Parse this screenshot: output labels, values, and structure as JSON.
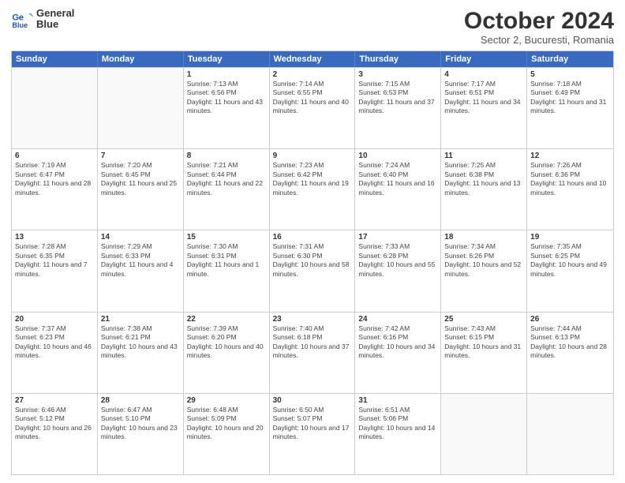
{
  "header": {
    "logo_line1": "General",
    "logo_line2": "Blue",
    "month": "October 2024",
    "location": "Sector 2, Bucuresti, Romania"
  },
  "days_of_week": [
    "Sunday",
    "Monday",
    "Tuesday",
    "Wednesday",
    "Thursday",
    "Friday",
    "Saturday"
  ],
  "weeks": [
    [
      {
        "day": "",
        "text": ""
      },
      {
        "day": "",
        "text": ""
      },
      {
        "day": "1",
        "text": "Sunrise: 7:13 AM\nSunset: 6:56 PM\nDaylight: 11 hours and 43 minutes."
      },
      {
        "day": "2",
        "text": "Sunrise: 7:14 AM\nSunset: 6:55 PM\nDaylight: 11 hours and 40 minutes."
      },
      {
        "day": "3",
        "text": "Sunrise: 7:15 AM\nSunset: 6:53 PM\nDaylight: 11 hours and 37 minutes."
      },
      {
        "day": "4",
        "text": "Sunrise: 7:17 AM\nSunset: 6:51 PM\nDaylight: 11 hours and 34 minutes."
      },
      {
        "day": "5",
        "text": "Sunrise: 7:18 AM\nSunset: 6:49 PM\nDaylight: 11 hours and 31 minutes."
      }
    ],
    [
      {
        "day": "6",
        "text": "Sunrise: 7:19 AM\nSunset: 6:47 PM\nDaylight: 11 hours and 28 minutes."
      },
      {
        "day": "7",
        "text": "Sunrise: 7:20 AM\nSunset: 6:45 PM\nDaylight: 11 hours and 25 minutes."
      },
      {
        "day": "8",
        "text": "Sunrise: 7:21 AM\nSunset: 6:44 PM\nDaylight: 11 hours and 22 minutes."
      },
      {
        "day": "9",
        "text": "Sunrise: 7:23 AM\nSunset: 6:42 PM\nDaylight: 11 hours and 19 minutes."
      },
      {
        "day": "10",
        "text": "Sunrise: 7:24 AM\nSunset: 6:40 PM\nDaylight: 11 hours and 16 minutes."
      },
      {
        "day": "11",
        "text": "Sunrise: 7:25 AM\nSunset: 6:38 PM\nDaylight: 11 hours and 13 minutes."
      },
      {
        "day": "12",
        "text": "Sunrise: 7:26 AM\nSunset: 6:36 PM\nDaylight: 11 hours and 10 minutes."
      }
    ],
    [
      {
        "day": "13",
        "text": "Sunrise: 7:28 AM\nSunset: 6:35 PM\nDaylight: 11 hours and 7 minutes."
      },
      {
        "day": "14",
        "text": "Sunrise: 7:29 AM\nSunset: 6:33 PM\nDaylight: 11 hours and 4 minutes."
      },
      {
        "day": "15",
        "text": "Sunrise: 7:30 AM\nSunset: 6:31 PM\nDaylight: 11 hours and 1 minute."
      },
      {
        "day": "16",
        "text": "Sunrise: 7:31 AM\nSunset: 6:30 PM\nDaylight: 10 hours and 58 minutes."
      },
      {
        "day": "17",
        "text": "Sunrise: 7:33 AM\nSunset: 6:28 PM\nDaylight: 10 hours and 55 minutes."
      },
      {
        "day": "18",
        "text": "Sunrise: 7:34 AM\nSunset: 6:26 PM\nDaylight: 10 hours and 52 minutes."
      },
      {
        "day": "19",
        "text": "Sunrise: 7:35 AM\nSunset: 6:25 PM\nDaylight: 10 hours and 49 minutes."
      }
    ],
    [
      {
        "day": "20",
        "text": "Sunrise: 7:37 AM\nSunset: 6:23 PM\nDaylight: 10 hours and 46 minutes."
      },
      {
        "day": "21",
        "text": "Sunrise: 7:38 AM\nSunset: 6:21 PM\nDaylight: 10 hours and 43 minutes."
      },
      {
        "day": "22",
        "text": "Sunrise: 7:39 AM\nSunset: 6:20 PM\nDaylight: 10 hours and 40 minutes."
      },
      {
        "day": "23",
        "text": "Sunrise: 7:40 AM\nSunset: 6:18 PM\nDaylight: 10 hours and 37 minutes."
      },
      {
        "day": "24",
        "text": "Sunrise: 7:42 AM\nSunset: 6:16 PM\nDaylight: 10 hours and 34 minutes."
      },
      {
        "day": "25",
        "text": "Sunrise: 7:43 AM\nSunset: 6:15 PM\nDaylight: 10 hours and 31 minutes."
      },
      {
        "day": "26",
        "text": "Sunrise: 7:44 AM\nSunset: 6:13 PM\nDaylight: 10 hours and 28 minutes."
      }
    ],
    [
      {
        "day": "27",
        "text": "Sunrise: 6:46 AM\nSunset: 5:12 PM\nDaylight: 10 hours and 26 minutes."
      },
      {
        "day": "28",
        "text": "Sunrise: 6:47 AM\nSunset: 5:10 PM\nDaylight: 10 hours and 23 minutes."
      },
      {
        "day": "29",
        "text": "Sunrise: 6:48 AM\nSunset: 5:09 PM\nDaylight: 10 hours and 20 minutes."
      },
      {
        "day": "30",
        "text": "Sunrise: 6:50 AM\nSunset: 5:07 PM\nDaylight: 10 hours and 17 minutes."
      },
      {
        "day": "31",
        "text": "Sunrise: 6:51 AM\nSunset: 5:06 PM\nDaylight: 10 hours and 14 minutes."
      },
      {
        "day": "",
        "text": ""
      },
      {
        "day": "",
        "text": ""
      }
    ]
  ]
}
